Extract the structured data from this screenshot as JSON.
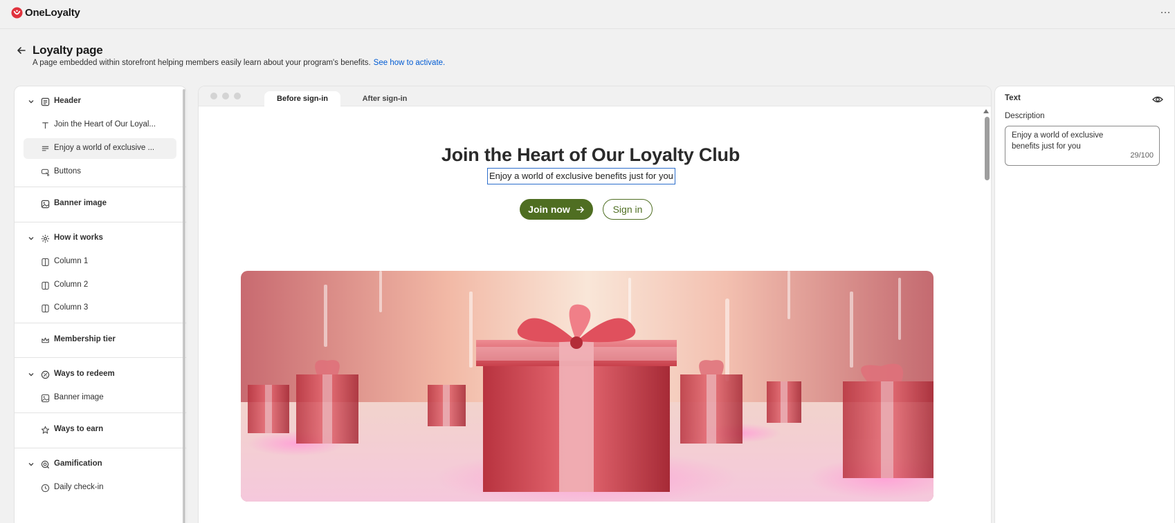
{
  "app": {
    "name": "OneLoyalty",
    "more_icon": "ellipsis-icon",
    "brand_color": "#e0323d"
  },
  "page": {
    "title": "Loyalty page",
    "subtitle": "A page embedded within storefront helping members easily learn about your program's benefits.",
    "subtitle_link": "See how to activate."
  },
  "sidebar": {
    "items": [
      {
        "label": "Header",
        "icon": "section-icon",
        "type": "group",
        "expanded": true
      },
      {
        "label": "Join the Heart of Our Loyal...",
        "icon": "text-icon",
        "type": "child"
      },
      {
        "label": "Enjoy a world of exclusive ...",
        "icon": "paragraph-icon",
        "type": "child",
        "selected": true
      },
      {
        "label": "Buttons",
        "icon": "button-icon",
        "type": "child"
      },
      {
        "label": "Banner image",
        "icon": "image-icon",
        "type": "group"
      },
      {
        "label": "How it works",
        "icon": "gear-icon",
        "type": "group",
        "expanded": true
      },
      {
        "label": "Column 1",
        "icon": "column-icon",
        "type": "child"
      },
      {
        "label": "Column 2",
        "icon": "column-icon",
        "type": "child"
      },
      {
        "label": "Column 3",
        "icon": "column-icon",
        "type": "child"
      },
      {
        "label": "Membership tier",
        "icon": "crown-icon",
        "type": "group"
      },
      {
        "label": "Ways to redeem",
        "icon": "redeem-icon",
        "type": "group",
        "expanded": true
      },
      {
        "label": "Banner image",
        "icon": "image-icon",
        "type": "child"
      },
      {
        "label": "Ways to earn",
        "icon": "star-icon",
        "type": "group"
      },
      {
        "label": "Gamification",
        "icon": "gamification-icon",
        "type": "group",
        "expanded": true
      },
      {
        "label": "Daily check-in",
        "icon": "checkin-icon",
        "type": "child"
      }
    ]
  },
  "preview": {
    "tabs": [
      {
        "label": "Before sign-in",
        "active": true
      },
      {
        "label": "After sign-in",
        "active": false
      }
    ],
    "hero": {
      "title": "Join the Heart of Our Loyalty Club",
      "description": "Enjoy a world of exclusive benefits just for you",
      "join_label": "Join now",
      "signin_label": "Sign in"
    },
    "accent_color": "#4f6e22"
  },
  "settings": {
    "section_title": "Text",
    "field_label": "Description",
    "field_value": "Enjoy a world of exclusive benefits just for you",
    "char_count": "29/100",
    "visibility_icon": "eye-icon"
  }
}
